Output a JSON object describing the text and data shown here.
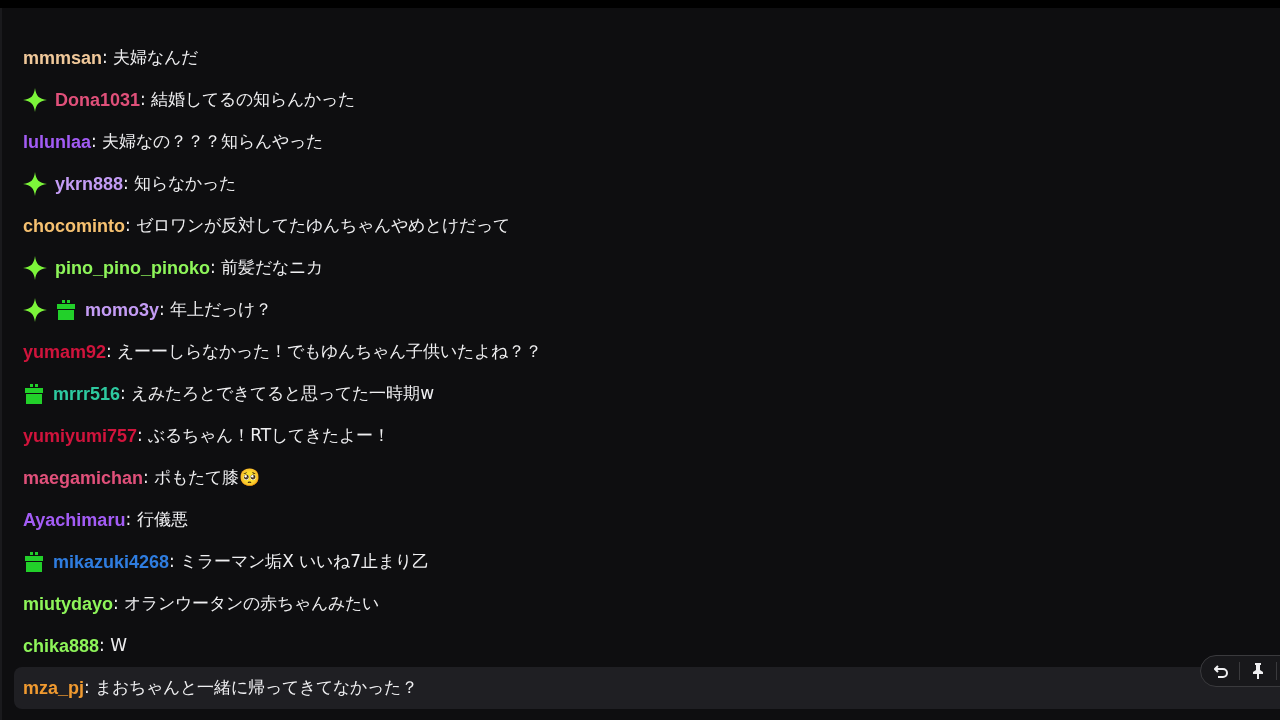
{
  "messages": [
    {
      "user": "mmmsan",
      "color": "#f0c89a",
      "text": ": 夫婦なんだ",
      "highlighted": false
    },
    {
      "user": "Dona1031",
      "color": "#e0507a",
      "badges": [
        {
          "kind": "sparkle"
        }
      ],
      "text": ": 結婚してるの知らんかった",
      "highlighted": false
    },
    {
      "user": "lulunlaa",
      "color": "#a35cf5",
      "text": ": 夫婦なの？？？知らんやった",
      "highlighted": false
    },
    {
      "user": "ykrn888",
      "color": "#c49cf5",
      "badges": [
        {
          "kind": "sparkle"
        }
      ],
      "text": ": 知らなかった",
      "highlighted": false
    },
    {
      "user": "chocominto",
      "color": "#f5c070",
      "text": ": ゼロワンが反対してたゆんちゃんやめとけだって",
      "highlighted": false
    },
    {
      "user": "pino_pino_pinoko",
      "color": "#8ef55a",
      "badges": [
        {
          "kind": "sparkle"
        }
      ],
      "text": ": 前髪だなニカ",
      "highlighted": false
    },
    {
      "user": "momo3y",
      "color": "#c49cf5",
      "badges": [
        {
          "kind": "sparkle"
        },
        {
          "kind": "gift"
        }
      ],
      "text": ": 年上だっけ？",
      "highlighted": false
    },
    {
      "user": "yumam92",
      "color": "#d0143c",
      "text": ": えーーしらなかった！でもゆんちゃん子供いたよね？？",
      "highlighted": false
    },
    {
      "user": "mrrr516",
      "color": "#2ec9a0",
      "badges": [
        {
          "kind": "gift"
        }
      ],
      "text": ": えみたろとできてると思ってた一時期w",
      "highlighted": false
    },
    {
      "user": "yumiyumi757",
      "color": "#d0143c",
      "text": ": ぶるちゃん！RTしてきたよー！",
      "highlighted": false
    },
    {
      "user": "maegamichan",
      "color": "#e0507a",
      "text": ": ポもたて膝🥺",
      "highlighted": false
    },
    {
      "user": "Ayachimaru",
      "color": "#a35cf5",
      "text": ": 行儀悪",
      "highlighted": false
    },
    {
      "user": "mikazuki4268",
      "color": "#2f7de0",
      "badges": [
        {
          "kind": "gift"
        }
      ],
      "text": ": ミラーマン垢X いいね7止まり乙",
      "highlighted": false
    },
    {
      "user": "miutydayo",
      "color": "#8ef55a",
      "text": ": オランウータンの赤ちゃんみたい",
      "highlighted": false
    },
    {
      "user": "chika888",
      "color": "#8ef55a",
      "text": ": W",
      "highlighted": false
    },
    {
      "user": "mza_pj",
      "color": "#f09a30",
      "text": ": まおちゃんと一緒に帰ってきてなかった？",
      "highlighted": true
    }
  ]
}
